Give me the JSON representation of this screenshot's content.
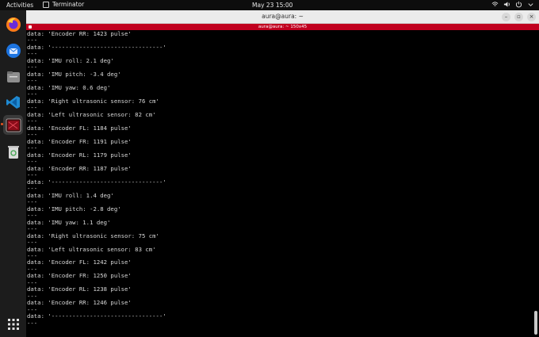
{
  "topbar": {
    "activities": "Activities",
    "app_name": "Terminator",
    "clock": "May 23  15:00",
    "tray_icons": [
      "network-icon",
      "volume-icon",
      "power-icon",
      "system-menu-arrow-icon"
    ]
  },
  "dock": {
    "items": [
      {
        "name": "firefox",
        "icon": "firefox-icon"
      },
      {
        "name": "thunderbird",
        "icon": "thunderbird-icon"
      },
      {
        "name": "files",
        "icon": "files-icon"
      },
      {
        "name": "vscode",
        "icon": "vscode-icon"
      },
      {
        "name": "terminator",
        "icon": "terminator-icon",
        "active": true
      },
      {
        "name": "trash",
        "icon": "trash-icon"
      }
    ],
    "show_apps_icon": "app-grid-icon"
  },
  "window": {
    "title": "aura@aura: ~",
    "tab_title": "aura@aura: ~ 150x45",
    "buttons": {
      "minimize": "–",
      "maximize": "▫",
      "close": "×"
    }
  },
  "terminal": {
    "lines": [
      "data: 'Encoder RR: 1423 pulse'",
      "---",
      "data: '--------------------------------'",
      "---",
      "data: 'IMU roll: 2.1 deg'",
      "---",
      "data: 'IMU pitch: -3.4 deg'",
      "---",
      "data: 'IMU yaw: 0.6 deg'",
      "---",
      "data: 'Right ultrasonic sensor: 76 cm'",
      "---",
      "data: 'Left ultrasonic sensor: 82 cm'",
      "---",
      "data: 'Encoder FL: 1184 pulse'",
      "---",
      "data: 'Encoder FR: 1191 pulse'",
      "---",
      "data: 'Encoder RL: 1179 pulse'",
      "---",
      "data: 'Encoder RR: 1187 pulse'",
      "---",
      "data: '--------------------------------'",
      "---",
      "data: 'IMU roll: 1.4 deg'",
      "---",
      "data: 'IMU pitch: -2.8 deg'",
      "---",
      "data: 'IMU yaw: 1.1 deg'",
      "---",
      "data: 'Right ultrasonic sensor: 75 cm'",
      "---",
      "data: 'Left ultrasonic sensor: 83 cm'",
      "---",
      "data: 'Encoder FL: 1242 pulse'",
      "---",
      "data: 'Encoder FR: 1250 pulse'",
      "---",
      "data: 'Encoder RL: 1238 pulse'",
      "---",
      "data: 'Encoder RR: 1246 pulse'",
      "---",
      "data: '--------------------------------'",
      "---"
    ]
  },
  "colors": {
    "tab_accent": "#c1001f",
    "ubuntu_orange": "#e95420",
    "terminal_bg": "#000000",
    "terminal_fg": "#d8d8d8"
  }
}
